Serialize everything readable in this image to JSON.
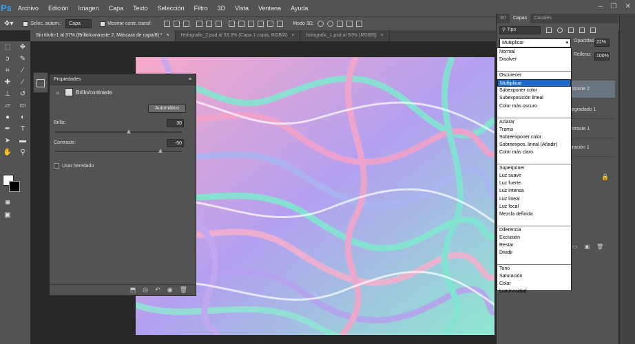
{
  "app": {
    "logo": "Ps"
  },
  "menu": [
    "Archivo",
    "Edición",
    "Imagen",
    "Capa",
    "Texto",
    "Selección",
    "Filtro",
    "3D",
    "Vista",
    "Ventana",
    "Ayuda"
  ],
  "window_controls": [
    "–",
    "❐",
    "✕"
  ],
  "options": {
    "auto_select": "Selec. autom.:",
    "auto_target": "Capa",
    "show_transform": "Mostrar contr. transf.",
    "mode3d": "Modo 3D:"
  },
  "tabs": [
    {
      "label": "Sin título-1 al 37% (Brillo/contraste 2, Máscara de capa/8) *",
      "active": true
    },
    {
      "label": "Holografic_2.psd al 33.3% (Capa 1 copia, RGB/8)",
      "active": false
    },
    {
      "label": "holografic_1.psd al 50% (RGB/8)",
      "active": false
    }
  ],
  "tab_close": "×",
  "properties": {
    "panel_title": "Propiedades",
    "adjustment_title": "Brillo/contraste",
    "auto_button": "Automático",
    "brightness_label": "Brillo:",
    "brightness_value": "30",
    "brightness_fraction": 0.58,
    "contrast_label": "Contraste:",
    "contrast_value": "-50",
    "contrast_fraction": 0.83,
    "legacy_label": "Usar heredado"
  },
  "layers_panel": {
    "tabs": [
      "3D",
      "Capas",
      "Canales"
    ],
    "filter": "Tipo",
    "blend_mode": "Multiplicar",
    "opacity_label": "Opacidad:",
    "opacity_value": "22%",
    "fill_label": "Relleno:",
    "fill_value": "100%",
    "layers": [
      {
        "label": "ontraste 2",
        "active": true
      },
      {
        "label": "Degradado 1",
        "active": false
      },
      {
        "label": "ontraste 1",
        "active": false
      },
      {
        "label": "turación 1",
        "active": false
      }
    ]
  },
  "blend_dropdown": [
    [
      "Normal",
      "Disolver"
    ],
    [
      "Oscurecer",
      "Multiplicar",
      "Subexponer color",
      "Subexposición lineal",
      "Color más oscuro"
    ],
    [
      "Aclarar",
      "Trama",
      "Sobreexponer color",
      "Sobreexpos. lineal (Añadir)",
      "Color más claro"
    ],
    [
      "Superponer",
      "Luz suave",
      "Luz fuerte",
      "Luz intensa",
      "Luz lineal",
      "Luz focal",
      "Mezcla definida"
    ],
    [
      "Diferencia",
      "Exclusión",
      "Restar",
      "Dividir"
    ],
    [
      "Tono",
      "Saturación",
      "Color",
      "Luminosidad"
    ]
  ],
  "selected_blend": "Multiplicar",
  "colors": {
    "accent": "#2fa4f3",
    "selection": "#1c69c8",
    "panel": "#535353"
  }
}
